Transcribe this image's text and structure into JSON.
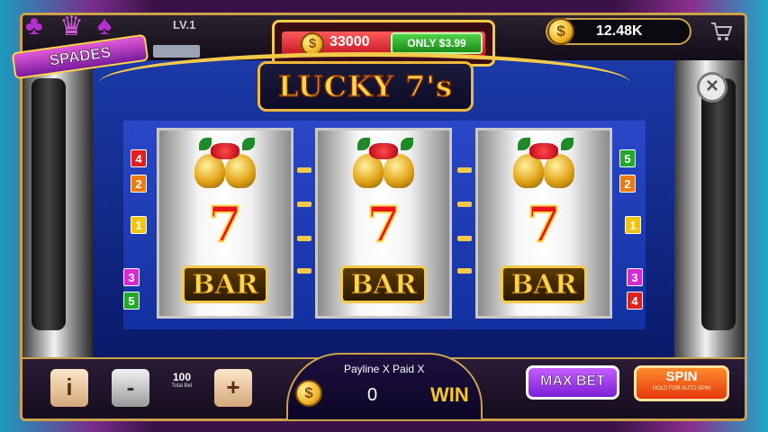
{
  "header": {
    "badge_label": "SPADES",
    "level": "LV.1",
    "jackpot_amount": "33000",
    "offer_button": "ONLY $3.99",
    "balance": "12.48K",
    "icons": [
      "coin-icon",
      "shopping-cart-icon",
      "close-icon"
    ]
  },
  "machine": {
    "title": "LUCKY 7's",
    "reels": [
      {
        "symbols": [
          "bells",
          "7",
          "BAR"
        ]
      },
      {
        "symbols": [
          "bells",
          "7",
          "BAR"
        ]
      },
      {
        "symbols": [
          "bells",
          "7",
          "BAR"
        ]
      }
    ],
    "paylines_left": [
      "4",
      "2",
      "1",
      "3",
      "5"
    ],
    "paylines_right": [
      "5",
      "2",
      "1",
      "3",
      "4"
    ],
    "seven": "7",
    "bar": "BAR"
  },
  "footer": {
    "info_button": "i",
    "minus_button": "-",
    "plus_button": "+",
    "total_bet_value": "100",
    "total_bet_label": "Total Bet",
    "payline_text": "Payline X Paid X",
    "win_value": "0",
    "win_label": "WIN",
    "max_bet_label": "MAX BET",
    "spin_label": "SPIN",
    "spin_hint": "HOLD FOR AUTO SPIN"
  },
  "colors": {
    "gold": "#f3c94b",
    "spin_orange": "#e4380e",
    "maxbet_purple": "#7b1fd6",
    "panel_blue": "#1b3aa8"
  }
}
